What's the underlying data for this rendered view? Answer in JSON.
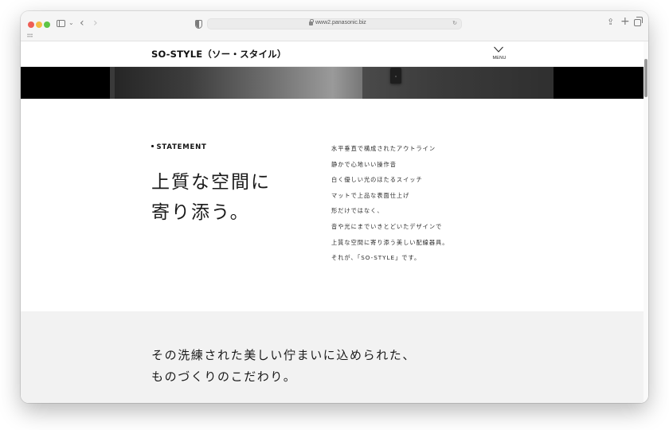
{
  "browser": {
    "url": "www2.panasonic.biz"
  },
  "header": {
    "title": "SO-STYLE（ソー・スタイル）",
    "menu_label": "MENU"
  },
  "statement": {
    "label": "STATEMENT",
    "heading_line1": "上質な空間に",
    "heading_line2": "寄り添う。",
    "lines": [
      "水平垂直で構成されたアウトライン",
      "静かで心地いい操作音",
      "白く優しい光のほたるスイッチ",
      "マットで上品な表面仕上げ",
      "形だけではなく、",
      "音や光にまでいきとどいたデザインで",
      "上質な空間に寄り添う美しい配線器具。",
      "それが、「SO-STYLE」です。"
    ]
  },
  "craft": {
    "heading_line1": "その洗練された美しい佇まいに込められた、",
    "heading_line2": "ものづくりのこだわり。"
  },
  "colors": {
    "accent": "#111111",
    "band_background": "#f2f2f2",
    "hero_background": "#000000"
  },
  "icons": [
    "sidebar-icon",
    "back-icon",
    "forward-icon",
    "shield-icon",
    "lock-icon",
    "reload-icon",
    "share-icon",
    "plus-icon",
    "tabs-icon",
    "menu-chevron-icon"
  ]
}
